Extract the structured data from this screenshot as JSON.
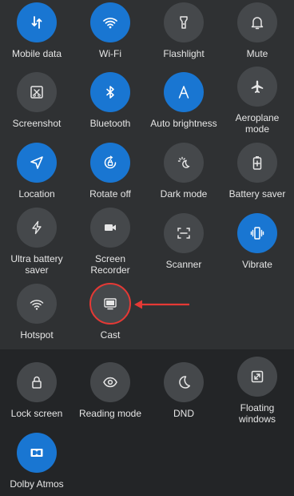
{
  "active_tiles": [
    {
      "label": "Mobile data",
      "icon": "mobile-data-icon",
      "on": true
    },
    {
      "label": "Wi-Fi",
      "icon": "wifi-icon",
      "on": true
    },
    {
      "label": "Flashlight",
      "icon": "flashlight-icon",
      "on": false
    },
    {
      "label": "Mute",
      "icon": "bell-icon",
      "on": false
    },
    {
      "label": "Screenshot",
      "icon": "screenshot-icon",
      "on": false
    },
    {
      "label": "Bluetooth",
      "icon": "bluetooth-icon",
      "on": true
    },
    {
      "label": "Auto brightness",
      "icon": "auto-brightness-icon",
      "on": true
    },
    {
      "label": "Aeroplane\nmode",
      "icon": "airplane-icon",
      "on": false
    },
    {
      "label": "Location",
      "icon": "location-icon",
      "on": true
    },
    {
      "label": "Rotate off",
      "icon": "rotate-lock-icon",
      "on": true
    },
    {
      "label": "Dark mode",
      "icon": "dark-mode-icon",
      "on": false
    },
    {
      "label": "Battery saver",
      "icon": "battery-saver-icon",
      "on": false
    },
    {
      "label": "Ultra battery\nsaver",
      "icon": "ultra-battery-saver-icon",
      "on": false
    },
    {
      "label": "Screen\nRecorder",
      "icon": "screen-recorder-icon",
      "on": false
    },
    {
      "label": "Scanner",
      "icon": "scanner-icon",
      "on": false
    },
    {
      "label": "Vibrate",
      "icon": "vibrate-icon",
      "on": true
    },
    {
      "label": "Hotspot",
      "icon": "hotspot-icon",
      "on": false
    },
    {
      "label": "Cast",
      "icon": "cast-icon",
      "on": false
    }
  ],
  "more_tiles": [
    {
      "label": "Lock screen",
      "icon": "lock-icon",
      "on": false
    },
    {
      "label": "Reading mode",
      "icon": "eye-icon",
      "on": false
    },
    {
      "label": "DND",
      "icon": "moon-icon",
      "on": false
    },
    {
      "label": "Floating\nwindows",
      "icon": "floating-window-icon",
      "on": false
    },
    {
      "label": "Dolby Atmos",
      "icon": "dolby-icon",
      "on": true
    }
  ],
  "colors": {
    "active_tile": "#1976d2",
    "inactive_tile": "#45484b",
    "highlight": "#e53935"
  }
}
